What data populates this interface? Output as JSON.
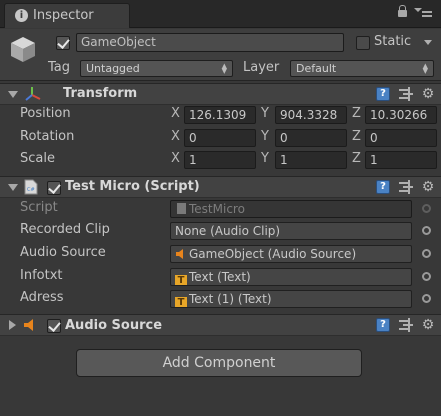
{
  "window": {
    "tab_icon": "i",
    "tab_title": "Inspector"
  },
  "gameobject": {
    "name": "GameObject",
    "static_label": "Static",
    "tag_label": "Tag",
    "tag_value": "Untagged",
    "layer_label": "Layer",
    "layer_value": "Default",
    "active": true,
    "static": false
  },
  "transform": {
    "title": "Transform",
    "rows": [
      {
        "label": "Position",
        "x": "126.1309",
        "y": "904.3328",
        "z": "10.30266"
      },
      {
        "label": "Rotation",
        "x": "0",
        "y": "0",
        "z": "0"
      },
      {
        "label": "Scale",
        "x": "1",
        "y": "1",
        "z": "1"
      }
    ],
    "axis_labels": {
      "x": "X",
      "y": "Y",
      "z": "Z"
    }
  },
  "script_component": {
    "title": "Test Micro (Script)",
    "enabled": true,
    "fields": [
      {
        "label": "Script",
        "value": "TestMicro",
        "icon": "script-asset-icon"
      },
      {
        "label": "Recorded Clip",
        "value": "None (Audio Clip)",
        "icon": ""
      },
      {
        "label": "Audio Source",
        "value": "GameObject (Audio Source)",
        "icon": "audio-source-icon"
      },
      {
        "label": "Infotxt",
        "value": "Text (Text)",
        "icon": "text-component-icon"
      },
      {
        "label": "Adress",
        "value": "Text (1) (Text)",
        "icon": "text-component-icon"
      }
    ]
  },
  "audio_component": {
    "title": "Audio Source",
    "enabled": true
  },
  "add_component_label": "Add Component",
  "colors": {
    "background": "#383838",
    "header": "#424242",
    "field": "#2a2a2a",
    "help_blue": "#4a82c4",
    "audio_orange": "#e8841c",
    "text_icon_yellow": "#e8a628"
  }
}
